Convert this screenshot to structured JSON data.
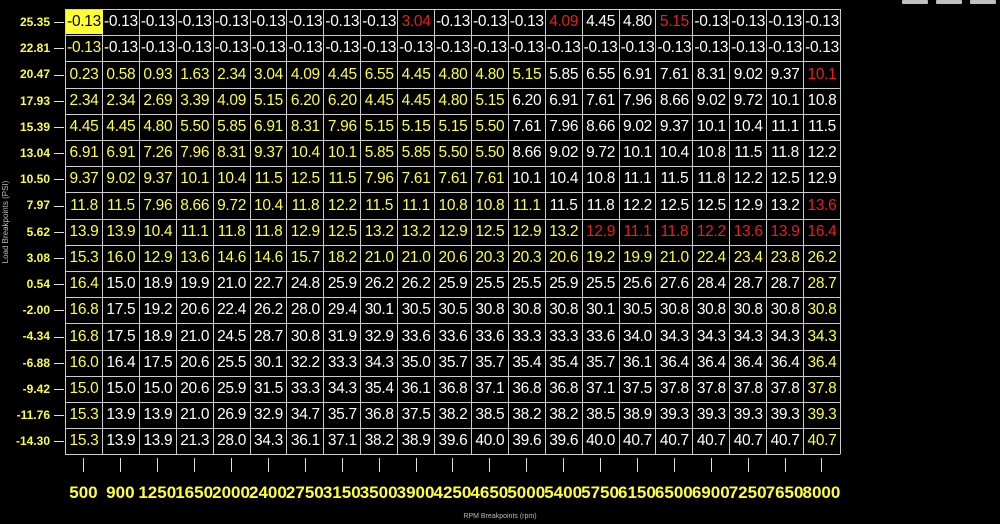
{
  "axes": {
    "y_title": "Load Breakpoints (PSI)",
    "x_title": "RPM Breakpoints (rpm)",
    "load_breakpoints": [
      "25.35",
      "22.81",
      "20.47",
      "17.93",
      "15.39",
      "13.04",
      "10.50",
      "7.97",
      "5.62",
      "3.08",
      "0.54",
      "-2.00",
      "-4.34",
      "-6.88",
      "-9.42",
      "-11.76",
      "-14.30"
    ],
    "rpm_breakpoints": [
      "500",
      "900",
      "1250",
      "1650",
      "2000",
      "2400",
      "2750",
      "3150",
      "3500",
      "3900",
      "4250",
      "4650",
      "5000",
      "5400",
      "5750",
      "6150",
      "6500",
      "6900",
      "7250",
      "7650",
      "8000"
    ]
  },
  "colors": {
    "background": "#000000",
    "axis_label": "#ffff33",
    "value_default": "#ffffff",
    "value_highlight": "#ffff33",
    "value_warning": "#ee1c1c",
    "selected_bg": "#ffff33",
    "grid_line": "#cccccc"
  },
  "selected_cell": {
    "row": 0,
    "col": 0
  },
  "table": {
    "values": [
      [
        "-0.13",
        "-0.13",
        "-0.13",
        "-0.13",
        "-0.13",
        "-0.13",
        "-0.13",
        "-0.13",
        "-0.13",
        "3.04",
        "-0.13",
        "-0.13",
        "-0.13",
        "4.09",
        "4.45",
        "4.80",
        "5.15",
        "-0.13",
        "-0.13",
        "-0.13",
        "-0.13"
      ],
      [
        "-0.13",
        "-0.13",
        "-0.13",
        "-0.13",
        "-0.13",
        "-0.13",
        "-0.13",
        "-0.13",
        "-0.13",
        "-0.13",
        "-0.13",
        "-0.13",
        "-0.13",
        "-0.13",
        "-0.13",
        "-0.13",
        "-0.13",
        "-0.13",
        "-0.13",
        "-0.13",
        "-0.13"
      ],
      [
        "0.23",
        "0.58",
        "0.93",
        "1.63",
        "2.34",
        "3.04",
        "4.09",
        "4.45",
        "6.55",
        "4.45",
        "4.80",
        "4.80",
        "5.15",
        "5.85",
        "6.55",
        "6.91",
        "7.61",
        "8.31",
        "9.02",
        "9.37",
        "10.1"
      ],
      [
        "2.34",
        "2.34",
        "2.69",
        "3.39",
        "4.09",
        "5.15",
        "6.20",
        "6.20",
        "4.45",
        "4.45",
        "4.80",
        "5.15",
        "6.20",
        "6.91",
        "7.61",
        "7.96",
        "8.66",
        "9.02",
        "9.72",
        "10.1",
        "10.8"
      ],
      [
        "4.45",
        "4.45",
        "4.80",
        "5.50",
        "5.85",
        "6.91",
        "8.31",
        "7.96",
        "5.15",
        "5.15",
        "5.15",
        "5.50",
        "7.61",
        "7.96",
        "8.66",
        "9.02",
        "9.37",
        "10.1",
        "10.4",
        "11.1",
        "11.5"
      ],
      [
        "6.91",
        "6.91",
        "7.26",
        "7.96",
        "8.31",
        "9.37",
        "10.4",
        "10.1",
        "5.85",
        "5.85",
        "5.50",
        "5.50",
        "8.66",
        "9.02",
        "9.72",
        "10.1",
        "10.4",
        "10.8",
        "11.5",
        "11.8",
        "12.2"
      ],
      [
        "9.37",
        "9.02",
        "9.37",
        "10.1",
        "10.4",
        "11.5",
        "12.5",
        "11.5",
        "7.96",
        "7.61",
        "7.61",
        "7.61",
        "10.1",
        "10.4",
        "10.8",
        "11.1",
        "11.5",
        "11.8",
        "12.2",
        "12.5",
        "12.9"
      ],
      [
        "11.8",
        "11.5",
        "7.96",
        "8.66",
        "9.72",
        "10.4",
        "11.8",
        "12.2",
        "11.5",
        "11.1",
        "10.8",
        "10.8",
        "11.1",
        "11.5",
        "11.8",
        "12.2",
        "12.5",
        "12.5",
        "12.9",
        "13.2",
        "13.6"
      ],
      [
        "13.9",
        "13.9",
        "10.4",
        "11.1",
        "11.8",
        "11.8",
        "12.9",
        "12.5",
        "13.2",
        "13.2",
        "12.9",
        "12.5",
        "12.9",
        "13.2",
        "12.9",
        "11.1",
        "11.8",
        "12.2",
        "13.6",
        "13.9",
        "16.4"
      ],
      [
        "15.3",
        "16.0",
        "12.9",
        "13.6",
        "14.6",
        "14.6",
        "15.7",
        "18.2",
        "21.0",
        "21.0",
        "20.6",
        "20.3",
        "20.3",
        "20.6",
        "19.2",
        "19.9",
        "21.0",
        "22.4",
        "23.4",
        "23.8",
        "26.2"
      ],
      [
        "16.4",
        "15.0",
        "18.9",
        "19.9",
        "21.0",
        "22.7",
        "24.8",
        "25.9",
        "26.2",
        "26.2",
        "25.9",
        "25.5",
        "25.5",
        "25.9",
        "25.5",
        "25.6",
        "27.6",
        "28.4",
        "28.7",
        "28.7",
        "28.7"
      ],
      [
        "16.8",
        "17.5",
        "19.2",
        "20.6",
        "22.4",
        "26.2",
        "28.0",
        "29.4",
        "30.1",
        "30.5",
        "30.5",
        "30.8",
        "30.8",
        "30.8",
        "30.1",
        "30.5",
        "30.8",
        "30.8",
        "30.8",
        "30.8",
        "30.8"
      ],
      [
        "16.8",
        "17.5",
        "18.9",
        "21.0",
        "24.5",
        "28.7",
        "30.8",
        "31.9",
        "32.9",
        "33.6",
        "33.6",
        "33.6",
        "33.3",
        "33.3",
        "33.6",
        "34.0",
        "34.3",
        "34.3",
        "34.3",
        "34.3",
        "34.3"
      ],
      [
        "16.0",
        "16.4",
        "17.5",
        "20.6",
        "25.5",
        "30.1",
        "32.2",
        "33.3",
        "34.3",
        "35.0",
        "35.7",
        "35.7",
        "35.4",
        "35.4",
        "35.7",
        "36.1",
        "36.4",
        "36.4",
        "36.4",
        "36.4",
        "36.4"
      ],
      [
        "15.0",
        "15.0",
        "15.0",
        "20.6",
        "25.9",
        "31.5",
        "33.3",
        "34.3",
        "35.4",
        "36.1",
        "36.8",
        "37.1",
        "36.8",
        "36.8",
        "37.1",
        "37.5",
        "37.8",
        "37.8",
        "37.8",
        "37.8",
        "37.8"
      ],
      [
        "15.3",
        "13.9",
        "13.9",
        "21.0",
        "26.9",
        "32.9",
        "34.7",
        "35.7",
        "36.8",
        "37.5",
        "38.2",
        "38.5",
        "38.2",
        "38.2",
        "38.5",
        "38.9",
        "39.3",
        "39.3",
        "39.3",
        "39.3",
        "39.3"
      ],
      [
        "15.3",
        "13.9",
        "13.9",
        "21.3",
        "28.0",
        "34.3",
        "36.1",
        "37.1",
        "38.2",
        "38.9",
        "39.6",
        "40.0",
        "39.6",
        "39.6",
        "40.0",
        "40.7",
        "40.7",
        "40.7",
        "40.7",
        "40.7",
        "40.7"
      ]
    ],
    "color_codes": [
      "SWWWWWWWWRWWWRWWRWWWW",
      "YWWWWWWWWWWWWWWWWWWWW",
      "YYYYYYYYYYYYYWWWWWWWR",
      "YYYYYYYYYYYYWWWWWWWWW",
      "YYYYYYYYYYYYWWWWWWWWW",
      "YYYYYYYYYYYYWWWWWWWWW",
      "YYYYYYYYYYYYWWWWWWWWW",
      "YYYYYYYYYYYYYWWWWWWWR",
      "YYYYYYYYYYYYYYRRRRRRR",
      "YYYYYYYYYYYYYYYYYYYYY",
      "YWWWWWWWWWWWWWWWWWWWY",
      "YWWWWWWWWWWWWWWWWWWWY",
      "YWWWWWWWWWWWWWWWWWWWY",
      "YWWWWWWWWWWWWWWWWWWWY",
      "YWWWWWWWWWWWWWWWWWWWY",
      "YWWWWWWWWWWWWWWWWWWWY",
      "YWWWWWWWWWWWWWWWWWWWY"
    ]
  }
}
